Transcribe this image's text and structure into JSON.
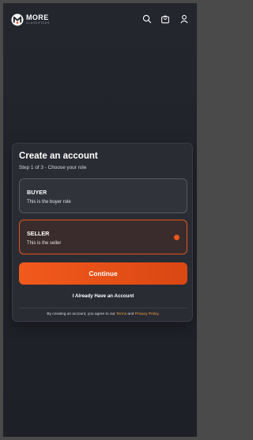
{
  "header": {
    "logo_word": "MORE",
    "logo_sub": "CLASSIFIEDS",
    "icons": [
      "search-icon",
      "cart-icon",
      "user-icon"
    ]
  },
  "card": {
    "title": "Create an account",
    "step": "Step 1 of 3 - Choose your role",
    "roles": [
      {
        "name": "BUYER",
        "description": "This is the buyer role",
        "selected": false
      },
      {
        "name": "SELLER",
        "description": "This is the seller",
        "selected": true
      }
    ],
    "continue_label": "Continue",
    "have_account_label": "I Already Have an Account",
    "terms": {
      "prefix": "By creating an account, you agree to our ",
      "terms_link": "Terms",
      "and": " and ",
      "privacy_link": "Privacy Policy",
      "suffix": "."
    }
  },
  "colors": {
    "accent": "#f0561e",
    "link": "#f2a23b",
    "background": "#22242b",
    "card": "#2a2c34"
  }
}
